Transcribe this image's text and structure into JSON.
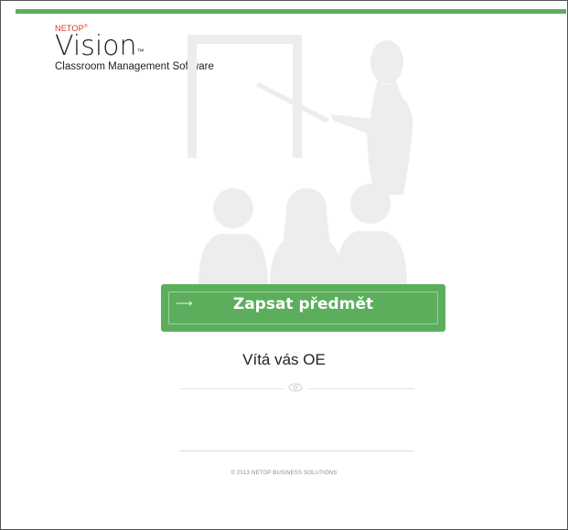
{
  "brand": {
    "company": "NETOP",
    "product": "Vision",
    "tagline": "Classroom Management Software"
  },
  "cta": {
    "label": "Zapsat předmět",
    "icon": "arrow-right-icon"
  },
  "welcome": "Vítá vás OE",
  "footer": {
    "copyright": "© 2013 NETOP BUSINESS SOLUTIONS"
  },
  "colors": {
    "accent": "#5cae5c",
    "brand_red": "#d9342b",
    "illustration": "#ededed"
  }
}
